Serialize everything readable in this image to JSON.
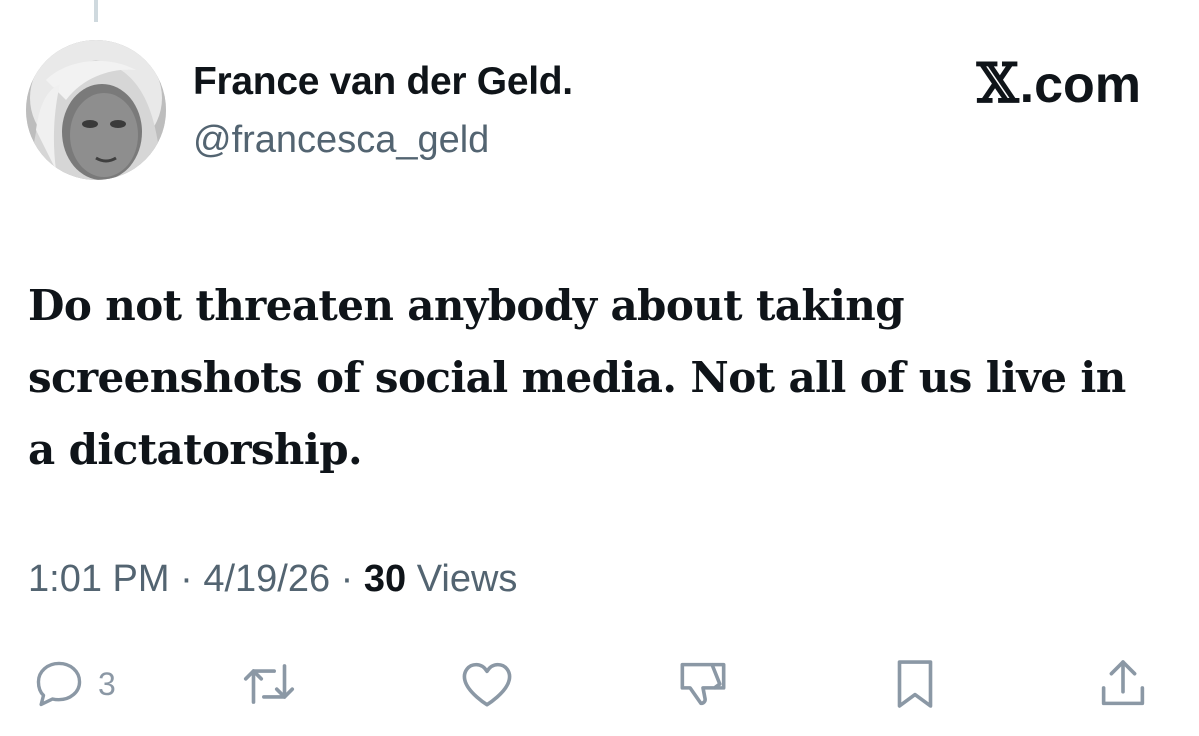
{
  "author": {
    "display_name": "France van der Geld.",
    "handle": "@francesca_geld"
  },
  "brand": {
    "icon": "x-logo-icon",
    "label": ".com"
  },
  "tweet": {
    "text": "Do not threaten anybody about taking screenshots of social media. Not all of us live in a dictatorship."
  },
  "meta": {
    "time": "1:01 PM",
    "separator": "·",
    "date": "4/19/26",
    "views_count": "30",
    "views_label": "Views"
  },
  "actions": {
    "reply": {
      "icon": "reply-icon",
      "count": "3"
    },
    "retweet": {
      "icon": "retweet-icon"
    },
    "like": {
      "icon": "heart-icon"
    },
    "dislike": {
      "icon": "thumbs-down-icon"
    },
    "bookmark": {
      "icon": "bookmark-icon"
    },
    "share": {
      "icon": "share-icon"
    }
  },
  "colors": {
    "text_primary": "#0f1419",
    "text_secondary": "#536471",
    "icon_gray": "#8b98a5",
    "thread_line": "#cfd9de"
  }
}
